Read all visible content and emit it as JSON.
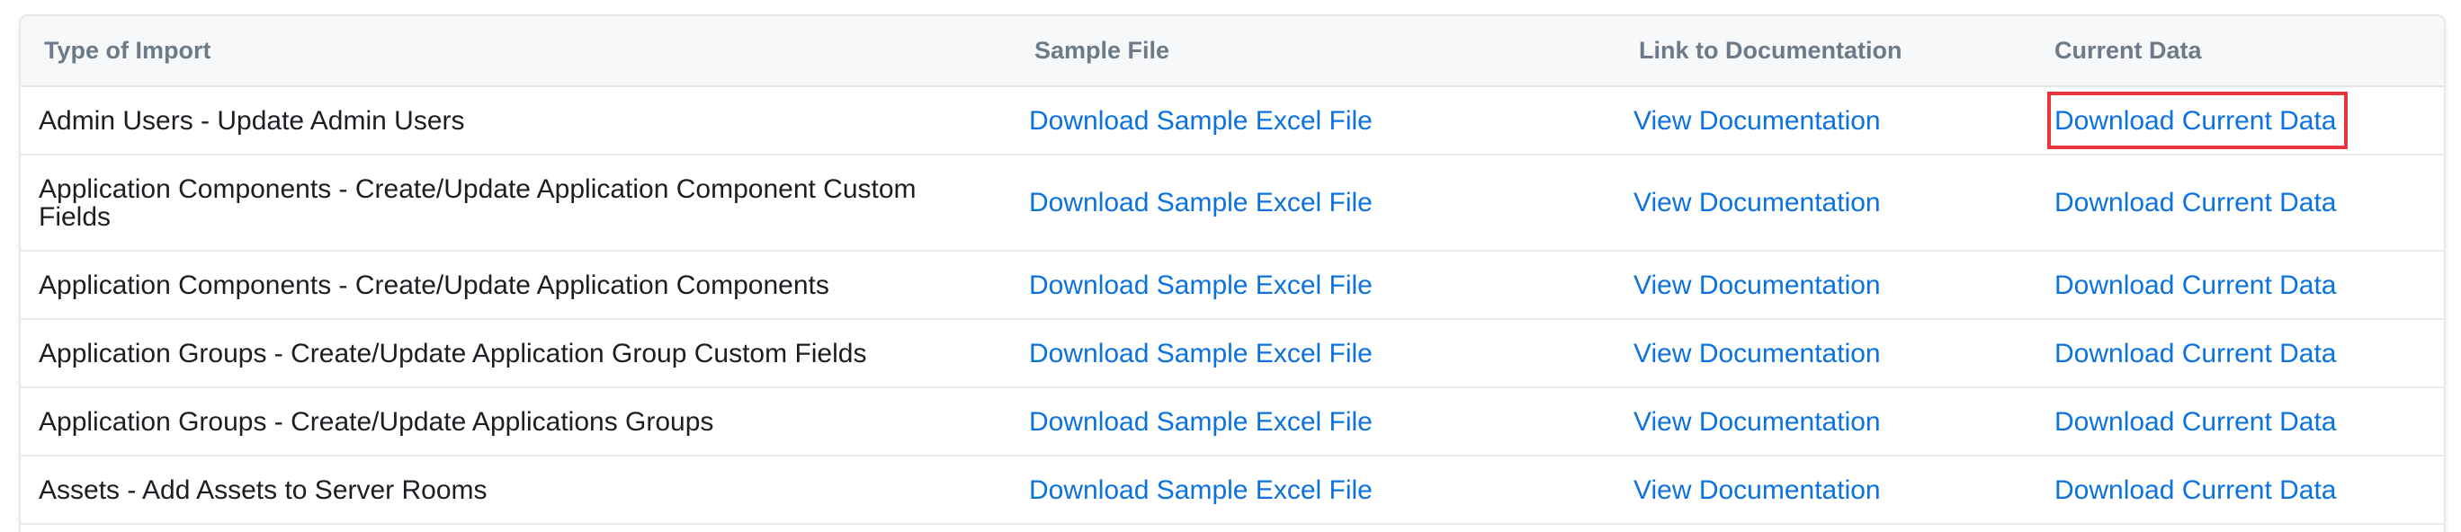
{
  "table": {
    "headers": {
      "type": "Type of Import",
      "sample": "Sample File",
      "docs": "Link to Documentation",
      "current": "Current Data"
    },
    "rows": [
      {
        "type": "Admin Users - Update Admin Users",
        "sample": "Download Sample Excel File",
        "docs": "View Documentation",
        "current": "Download Current Data",
        "highlighted": true
      },
      {
        "type": "Application Components - Create/Update Application Component Custom Fields",
        "sample": "Download Sample Excel File",
        "docs": "View Documentation",
        "current": "Download Current Data"
      },
      {
        "type": "Application Components - Create/Update Application Components",
        "sample": "Download Sample Excel File",
        "docs": "View Documentation",
        "current": "Download Current Data"
      },
      {
        "type": "Application Groups - Create/Update Application Group Custom Fields",
        "sample": "Download Sample Excel File",
        "docs": "View Documentation",
        "current": "Download Current Data"
      },
      {
        "type": "Application Groups - Create/Update Applications Groups",
        "sample": "Download Sample Excel File",
        "docs": "View Documentation",
        "current": "Download Current Data"
      },
      {
        "type": "Assets - Add Assets to Server Rooms",
        "sample": "Download Sample Excel File",
        "docs": "View Documentation",
        "current": "Download Current Data"
      }
    ]
  },
  "colors": {
    "link": "#0b72e0",
    "header_text": "#6c7a89",
    "highlight_border": "#e8343a"
  }
}
